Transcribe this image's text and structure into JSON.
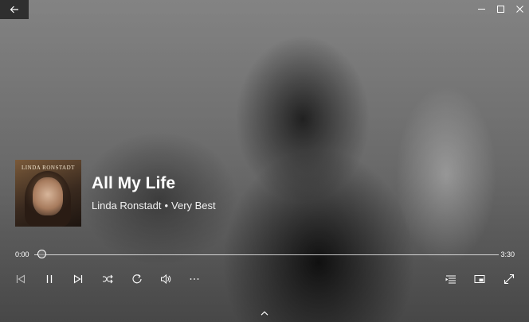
{
  "track": {
    "title": "All My Life",
    "artist": "Linda Ronstadt",
    "separator": "•",
    "album": "Very Best"
  },
  "album_art": {
    "art_text": "LINDA RONSTADT"
  },
  "playback": {
    "elapsed": "0:00",
    "duration": "3:30",
    "progress_fraction": 0.0
  },
  "colors": {
    "title_bar_button_bg": "#2f2f2f",
    "text": "#ffffff"
  },
  "icons": {
    "back": "back-arrow-icon",
    "minimize": "minimize-icon",
    "maximize": "maximize-icon",
    "close": "close-icon",
    "previous": "previous-track-icon",
    "pause": "pause-icon",
    "next": "next-track-icon",
    "shuffle": "shuffle-icon",
    "repeat": "repeat-icon",
    "volume": "volume-icon",
    "more": "more-options-icon",
    "now_playing_list": "now-playing-list-icon",
    "mini_view": "mini-view-icon",
    "full_screen": "full-screen-icon",
    "expand": "chevron-up-icon"
  }
}
